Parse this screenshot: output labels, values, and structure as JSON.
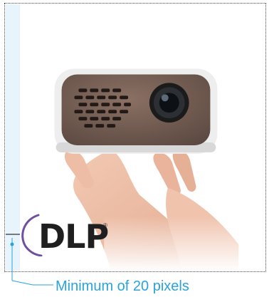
{
  "logo": {
    "text": "DLP",
    "registered": "®"
  },
  "annotation": {
    "caption": "Minimum of 20 pixels",
    "color": "#29a3df"
  },
  "icons": [
    "projector-photo",
    "hand-photo",
    "dlp-logo",
    "margin-guide"
  ]
}
